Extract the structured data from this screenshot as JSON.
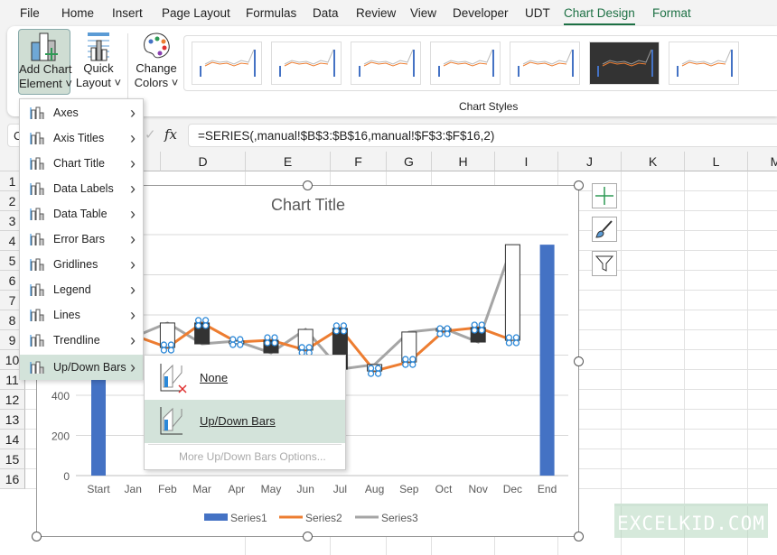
{
  "tabs": [
    "File",
    "Home",
    "Insert",
    "Page Layout",
    "Formulas",
    "Data",
    "Review",
    "View",
    "Developer",
    "UDT",
    "Chart Design",
    "Format"
  ],
  "active_tab": "Chart Design",
  "ribbon": {
    "add_chart_element_1": "Add Chart",
    "add_chart_element_2": "Element",
    "quick_layout_1": "Quick",
    "quick_layout_2": "Layout",
    "change_colors_1": "Change",
    "change_colors_2": "Colors",
    "chart_styles_label": "Chart Styles"
  },
  "formula_bar": {
    "name_box": "C",
    "fx": "fx",
    "formula": "=SERIES(,manual!$B$3:$B$16,manual!$F$3:$F$16,2)"
  },
  "columns": [
    "D",
    "E",
    "F",
    "G",
    "H",
    "I",
    "J",
    "K",
    "L",
    "M"
  ],
  "rows": [
    "1",
    "2",
    "3",
    "4",
    "5",
    "6",
    "7",
    "8",
    "9",
    "10",
    "11",
    "12",
    "13",
    "14",
    "15",
    "16"
  ],
  "menu": {
    "items": [
      "Axes",
      "Axis Titles",
      "Chart Title",
      "Data Labels",
      "Data Table",
      "Error Bars",
      "Gridlines",
      "Legend",
      "Lines",
      "Trendline",
      "Up/Down Bars"
    ],
    "highlighted": "Up/Down Bars"
  },
  "submenu": {
    "none": "None",
    "updown": "Up/Down Bars",
    "more": "More Up/Down Bars Options..."
  },
  "watermark": "EXCELKID.COM",
  "chart_data": {
    "type": "bar+line",
    "title": "Chart Title",
    "categories": [
      "Start",
      "Jan",
      "Feb",
      "Mar",
      "Apr",
      "May",
      "Jun",
      "Jul",
      "Aug",
      "Sep",
      "Oct",
      "Nov",
      "Dec",
      "End"
    ],
    "yticks": [
      0,
      200,
      400
    ],
    "ylim": [
      0,
      1200
    ],
    "grid": true,
    "legend": "bottom",
    "series": [
      {
        "name": "Series1",
        "type": "bar",
        "color": "#4472c4",
        "values": [
          1150,
          null,
          null,
          null,
          null,
          null,
          null,
          null,
          null,
          null,
          null,
          null,
          null,
          1150
        ]
      },
      {
        "name": "Series2",
        "type": "line",
        "color": "#ed7d31",
        "values": [
          null,
          700,
          638,
          760,
          665,
          674,
          625,
          733,
          521,
          566,
          719,
          737,
          674,
          null
        ]
      },
      {
        "name": "Series3",
        "type": "line",
        "color": "#a5a5a5",
        "values": [
          null,
          688,
          760,
          656,
          670,
          611,
          728,
          530,
          553,
          715,
          733,
          665,
          1150,
          null
        ]
      }
    ],
    "up_down_bars": true
  }
}
